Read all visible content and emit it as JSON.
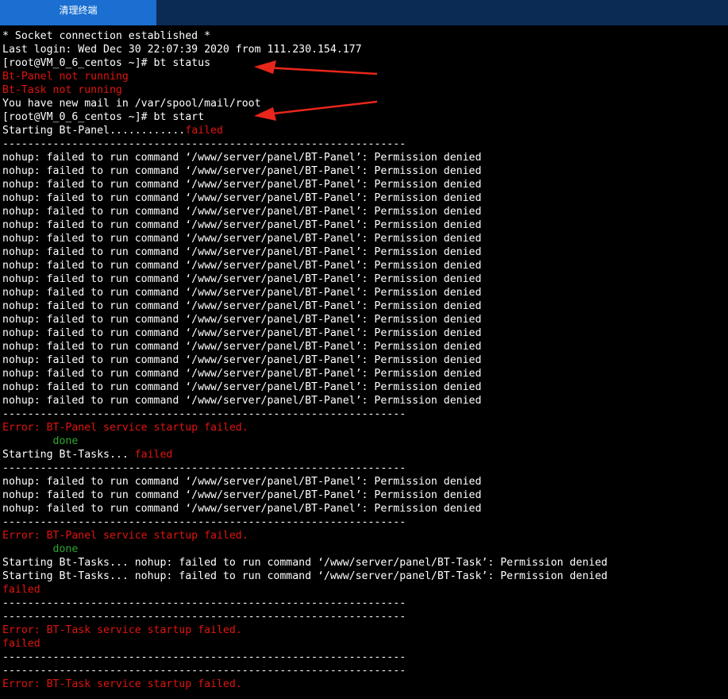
{
  "tab": {
    "label": "清理终端"
  },
  "terminal": {
    "lines": [
      [
        {
          "t": "* Socket connection established *",
          "c": "w"
        }
      ],
      [
        {
          "t": "Last login: Wed Dec 30 22:07:39 2020 from 111.230.154.177",
          "c": "w"
        }
      ],
      [
        {
          "t": "[root@VM_0_6_centos ~]# bt status",
          "c": "w"
        }
      ],
      [
        {
          "t": "Bt-Panel not running",
          "c": "r"
        }
      ],
      [
        {
          "t": "Bt-Task not running",
          "c": "r"
        }
      ],
      [
        {
          "t": "You have new mail in /var/spool/mail/root",
          "c": "w"
        }
      ],
      [
        {
          "t": "[root@VM_0_6_centos ~]# bt start",
          "c": "w"
        }
      ],
      [
        {
          "t": "Starting Bt-Panel............",
          "c": "w"
        },
        {
          "t": "failed",
          "c": "r"
        }
      ],
      [
        {
          "t": "----------------------------------------------------------------",
          "c": "w"
        }
      ],
      [
        {
          "t": "nohup: failed to run command ‘/www/server/panel/BT-Panel’: Permission denied",
          "c": "w"
        }
      ],
      [
        {
          "t": "nohup: failed to run command ‘/www/server/panel/BT-Panel’: Permission denied",
          "c": "w"
        }
      ],
      [
        {
          "t": "nohup: failed to run command ‘/www/server/panel/BT-Panel’: Permission denied",
          "c": "w"
        }
      ],
      [
        {
          "t": "nohup: failed to run command ‘/www/server/panel/BT-Panel’: Permission denied",
          "c": "w"
        }
      ],
      [
        {
          "t": "nohup: failed to run command ‘/www/server/panel/BT-Panel’: Permission denied",
          "c": "w"
        }
      ],
      [
        {
          "t": "nohup: failed to run command ‘/www/server/panel/BT-Panel’: Permission denied",
          "c": "w"
        }
      ],
      [
        {
          "t": "nohup: failed to run command ‘/www/server/panel/BT-Panel’: Permission denied",
          "c": "w"
        }
      ],
      [
        {
          "t": "nohup: failed to run command ‘/www/server/panel/BT-Panel’: Permission denied",
          "c": "w"
        }
      ],
      [
        {
          "t": "nohup: failed to run command ‘/www/server/panel/BT-Panel’: Permission denied",
          "c": "w"
        }
      ],
      [
        {
          "t": "nohup: failed to run command ‘/www/server/panel/BT-Panel’: Permission denied",
          "c": "w"
        }
      ],
      [
        {
          "t": "nohup: failed to run command ‘/www/server/panel/BT-Panel’: Permission denied",
          "c": "w"
        }
      ],
      [
        {
          "t": "nohup: failed to run command ‘/www/server/panel/BT-Panel’: Permission denied",
          "c": "w"
        }
      ],
      [
        {
          "t": "nohup: failed to run command ‘/www/server/panel/BT-Panel’: Permission denied",
          "c": "w"
        }
      ],
      [
        {
          "t": "nohup: failed to run command ‘/www/server/panel/BT-Panel’: Permission denied",
          "c": "w"
        }
      ],
      [
        {
          "t": "nohup: failed to run command ‘/www/server/panel/BT-Panel’: Permission denied",
          "c": "w"
        }
      ],
      [
        {
          "t": "nohup: failed to run command ‘/www/server/panel/BT-Panel’: Permission denied",
          "c": "w"
        }
      ],
      [
        {
          "t": "nohup: failed to run command ‘/www/server/panel/BT-Panel’: Permission denied",
          "c": "w"
        }
      ],
      [
        {
          "t": "nohup: failed to run command ‘/www/server/panel/BT-Panel’: Permission denied",
          "c": "w"
        }
      ],
      [
        {
          "t": "nohup: failed to run command ‘/www/server/panel/BT-Panel’: Permission denied",
          "c": "w"
        }
      ],
      [
        {
          "t": "----------------------------------------------------------------",
          "c": "w"
        }
      ],
      [
        {
          "t": "Error: BT-Panel service startup failed.",
          "c": "r"
        }
      ],
      [
        {
          "t": "        ",
          "c": "w"
        },
        {
          "t": "done",
          "c": "g"
        }
      ],
      [
        {
          "t": "Starting Bt-Tasks... ",
          "c": "w"
        },
        {
          "t": "failed",
          "c": "r"
        }
      ],
      [
        {
          "t": "----------------------------------------------------------------",
          "c": "w"
        }
      ],
      [
        {
          "t": "nohup: failed to run command ‘/www/server/panel/BT-Panel’: Permission denied",
          "c": "w"
        }
      ],
      [
        {
          "t": "nohup: failed to run command ‘/www/server/panel/BT-Panel’: Permission denied",
          "c": "w"
        }
      ],
      [
        {
          "t": "nohup: failed to run command ‘/www/server/panel/BT-Panel’: Permission denied",
          "c": "w"
        }
      ],
      [
        {
          "t": "----------------------------------------------------------------",
          "c": "w"
        }
      ],
      [
        {
          "t": "Error: BT-Panel service startup failed.",
          "c": "r"
        }
      ],
      [
        {
          "t": "        ",
          "c": "w"
        },
        {
          "t": "done",
          "c": "g"
        }
      ],
      [
        {
          "t": "Starting Bt-Tasks... nohup: failed to run command ‘/www/server/panel/BT-Task’: Permission denied",
          "c": "w"
        }
      ],
      [
        {
          "t": "Starting Bt-Tasks... nohup: failed to run command ‘/www/server/panel/BT-Task’: Permission denied",
          "c": "w"
        }
      ],
      [
        {
          "t": "failed",
          "c": "r"
        }
      ],
      [
        {
          "t": "----------------------------------------------------------------",
          "c": "w"
        }
      ],
      [
        {
          "t": "----------------------------------------------------------------",
          "c": "w"
        }
      ],
      [
        {
          "t": "Error: BT-Task service startup failed.",
          "c": "r"
        }
      ],
      [
        {
          "t": "failed",
          "c": "r"
        }
      ],
      [
        {
          "t": "----------------------------------------------------------------",
          "c": "w"
        }
      ],
      [
        {
          "t": "----------------------------------------------------------------",
          "c": "w"
        }
      ],
      [
        {
          "t": "Error: BT-Task service startup failed.",
          "c": "r"
        }
      ]
    ]
  },
  "colors": {
    "w": "#ffffff",
    "r": "#e0140f",
    "g": "#2ea62e",
    "arrow": "#e8261b"
  }
}
